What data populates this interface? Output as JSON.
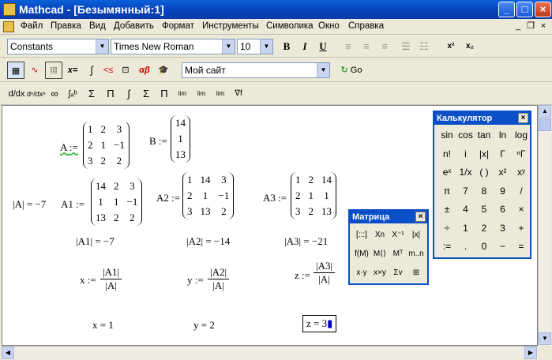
{
  "window": {
    "title": "Mathcad - [Безымянный:1]",
    "min": "_",
    "max": "□",
    "close": "×"
  },
  "menu": [
    "Файл",
    "Правка",
    "Вид",
    "Добавить",
    "Формат",
    "Инструменты",
    "Символика",
    "Окно",
    "Справка"
  ],
  "mdi": {
    "min": "_",
    "restore": "❐",
    "close": "×"
  },
  "format": {
    "style": "Constants",
    "font": "Times New Roman",
    "size": "10",
    "bold": "B",
    "italic": "I",
    "underline": "U",
    "sup": "x²",
    "sub": "x₂"
  },
  "standard": {
    "site": "Мой сайт",
    "go": "Go"
  },
  "toolbar_icons": {
    "calc": "calc-toolbar-icon",
    "graph": "graph-toolbar-icon",
    "matrix": "matrix-toolbar-icon",
    "eval": "x=",
    "calculus": "calculus-toolbar-icon",
    "boolean": "boolean-toolbar-icon",
    "programming": "programming-toolbar-icon",
    "greek": "αβ",
    "symbolic": "symbolic-toolbar-icon"
  },
  "calculus_bar": [
    "d/dx",
    "dⁿ/dxⁿ",
    "∞",
    "∫ₐᵇ",
    "Σ",
    "Π",
    "∫",
    "Σ",
    "Π",
    "lim",
    "lim",
    "lim",
    "∇f"
  ],
  "worksheet": {
    "A_def": {
      "name": "A",
      "op": ":=",
      "rows": [
        [
          "1",
          "2",
          "3"
        ],
        [
          "2",
          "1",
          "−1"
        ],
        [
          "3",
          "2",
          "2"
        ]
      ]
    },
    "B_def": {
      "name": "B",
      "op": ":=",
      "rows": [
        [
          "14"
        ],
        [
          "1"
        ],
        [
          "13"
        ]
      ]
    },
    "detA": "|A| = −7",
    "A1_def": {
      "name": "A1",
      "op": ":=",
      "rows": [
        [
          "14",
          "2",
          "3"
        ],
        [
          "1",
          "1",
          "−1"
        ],
        [
          "13",
          "2",
          "2"
        ]
      ]
    },
    "A2_def": {
      "name": "A2",
      "op": ":=",
      "rows": [
        [
          "1",
          "14",
          "3"
        ],
        [
          "2",
          "1",
          "−1"
        ],
        [
          "3",
          "13",
          "2"
        ]
      ]
    },
    "A3_def": {
      "name": "A3",
      "op": ":=",
      "rows": [
        [
          "1",
          "2",
          "14"
        ],
        [
          "2",
          "1",
          "1"
        ],
        [
          "3",
          "2",
          "13"
        ]
      ]
    },
    "detA1": "|A1| = −7",
    "detA2": "|A2| = −14",
    "detA3": "|A3| = −21",
    "x_def": {
      "lhs": "x :=",
      "num": "|A1|",
      "den": "|A|"
    },
    "y_def": {
      "lhs": "y :=",
      "num": "|A2|",
      "den": "|A|"
    },
    "z_def": {
      "lhs": "z :=",
      "num": "|A3|",
      "den": "|A|"
    },
    "x_res": "x = 1",
    "y_res": "y = 2",
    "z_res": "z = 3"
  },
  "calculator": {
    "title": "Калькулятор",
    "close": "×",
    "keys": [
      [
        "sin",
        "cos",
        "tan",
        "ln",
        "log"
      ],
      [
        "n!",
        "i",
        "|x|",
        "Γ",
        "ⁿΓ"
      ],
      [
        "eˣ",
        "1/x",
        "( )",
        "x²",
        "xʸ"
      ],
      [
        "π",
        "7",
        "8",
        "9",
        "/"
      ],
      [
        "±",
        "4",
        "5",
        "6",
        "×"
      ],
      [
        "÷",
        "1",
        "2",
        "3",
        "+"
      ],
      [
        ":=",
        ".",
        "0",
        "−",
        "="
      ]
    ]
  },
  "matrix_pal": {
    "title": "Матрица",
    "close": "×",
    "keys": [
      [
        "[:::]",
        "Xn",
        "X⁻¹",
        "|x|"
      ],
      [
        "f(M)",
        "M⟨⟩",
        "Mᵀ",
        "m..n"
      ],
      [
        "x·y",
        "x×y",
        "Σv",
        "⊞"
      ]
    ]
  }
}
